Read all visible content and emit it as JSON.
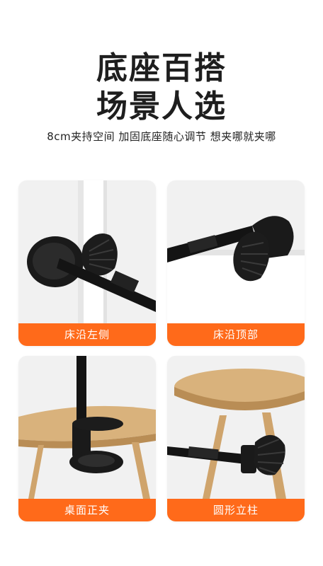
{
  "heading": {
    "line1": "底座百搭",
    "line2": "场景人选"
  },
  "subtitle": "8cm夹持空间  加固底座随心调节  想夹哪就夹哪",
  "cards": [
    {
      "label": "床沿左侧"
    },
    {
      "label": "床沿顶部"
    },
    {
      "label": "桌面正夹"
    },
    {
      "label": "圆形立柱"
    }
  ],
  "colors": {
    "accent": "#ff6a1a",
    "card_bg": "#f2f2f2",
    "clamp": "#151515",
    "wood": "#d9b27c"
  }
}
